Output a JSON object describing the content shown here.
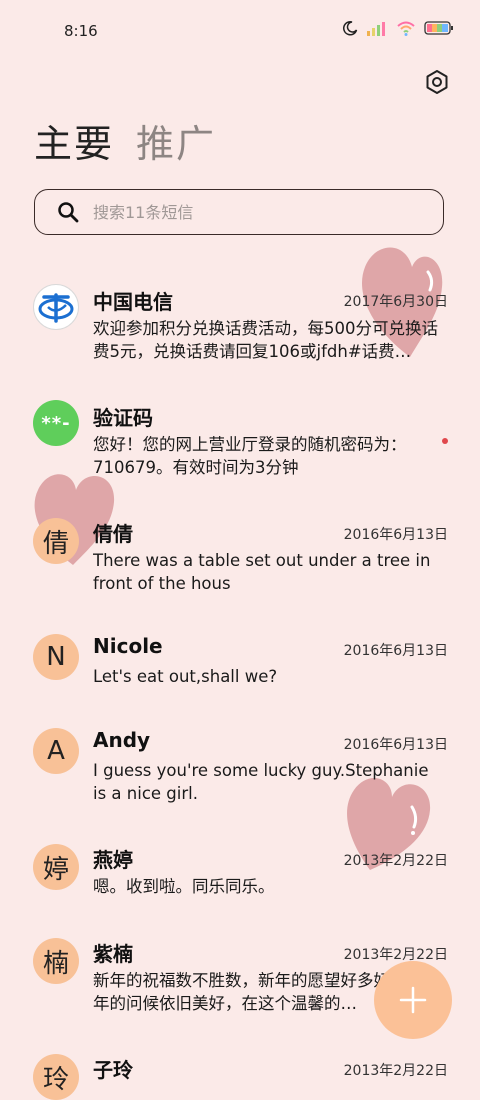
{
  "status": {
    "time": "8:16"
  },
  "tabs": [
    {
      "label": "主要"
    },
    {
      "label": "推广"
    }
  ],
  "search": {
    "placeholder": "搜索11条短信"
  },
  "conversations": [
    {
      "name": "中国电信",
      "date": "2017年6月30日",
      "preview": "欢迎参加积分兑换话费活动，每500分可兑换话费5元，兑换话费请回复106或jfdh#话费…",
      "avatar_icon": "china-telecom-logo"
    },
    {
      "name": "验证码",
      "date": "",
      "preview": "您好！您的网上营业厅登录的随机密码为：710679。有效时间为3分钟",
      "avatar_text": "**-"
    },
    {
      "name": "倩倩",
      "date": "2016年6月13日",
      "preview": "There was a table set out under a tree in front of the hous",
      "avatar_text": "倩"
    },
    {
      "name": "Nicole",
      "date": "2016年6月13日",
      "preview": "Let's eat out,shall we?",
      "avatar_text": "N"
    },
    {
      "name": "Andy",
      "date": "2016年6月13日",
      "preview": "I guess you're some lucky guy.Stephanie is a nice girl.",
      "avatar_text": "A"
    },
    {
      "name": "燕婷",
      "date": "2013年2月22日",
      "preview": "嗯。收到啦。同乐同乐。",
      "avatar_text": "婷"
    },
    {
      "name": "紫楠",
      "date": "2013年2月22日",
      "preview": "新年的祝福数不胜数，新年的愿望好多好多，新年的问候依旧美好，在这个温馨的…",
      "avatar_text": "楠"
    },
    {
      "name": "子玲",
      "date": "2013年2月22日",
      "preview": "",
      "avatar_text": "玲"
    }
  ],
  "colors": {
    "background": "#fbeae8",
    "avatar": "#f8c197",
    "fab": "#fbc197",
    "verify_avatar": "#5fce5b"
  }
}
